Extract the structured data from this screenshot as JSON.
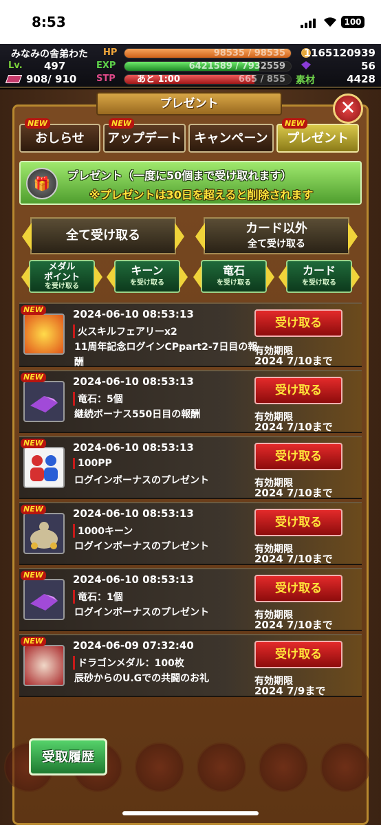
{
  "status": {
    "time": "8:53",
    "battery": "100"
  },
  "player": {
    "name": "みなみの舎弟わた",
    "lv_label": "Lv.",
    "lv": "497",
    "cards": "908/ 910",
    "hp_label": "HP",
    "hp": "98535 / 98535",
    "exp_label": "EXP",
    "exp": "6421589 / 7932559",
    "stp_label": "STP",
    "stp_remaining": "あと 1:00",
    "stp": "665 / 855",
    "gold": "1165120939",
    "gems": "56",
    "sozai_label": "素材",
    "sozai": "4428",
    "hp_ratio": 1.0,
    "exp_ratio": 0.81,
    "stp_ratio": 0.78
  },
  "panel": {
    "title": "プレゼント",
    "close": "✕"
  },
  "tabs": [
    {
      "label": "おしらせ",
      "new": "NEW"
    },
    {
      "label": "アップデート",
      "new": "NEW"
    },
    {
      "label": "キャンペーン",
      "new": ""
    },
    {
      "label": "プレゼント",
      "new": "NEW"
    }
  ],
  "notice": {
    "line1": "プレゼント（一度に50個まで受け取れます）",
    "line2": "※プレゼントは30日を超えると削除されます"
  },
  "actions": {
    "receive_all": "全て受け取る",
    "except_cards_1": "カード以外",
    "except_cards_2": "全て受け取る",
    "medal_1": "メダル",
    "medal_2": "ポイント",
    "medal_3": "を受け取る",
    "kin_1": "キーン",
    "kin_2": "を受け取る",
    "ryu_1": "竜石",
    "ryu_2": "を受け取る",
    "card_1": "カード",
    "card_2": "を受け取る"
  },
  "presents": [
    {
      "new": "NEW",
      "date": "2024-06-10 08:53:13",
      "item": "火スキルフェアリーx2",
      "desc": "11周年記念ログインCPpart2-7日目の報酬",
      "button": "受け取る",
      "exp_label": "有効期限",
      "exp": "2024 7/10まで"
    },
    {
      "new": "NEW",
      "date": "2024-06-10 08:53:13",
      "item": "竜石：5個",
      "desc": "継続ボーナス550日目の報酬",
      "button": "受け取る",
      "exp_label": "有効期限",
      "exp": "2024 7/10まで"
    },
    {
      "new": "NEW",
      "date": "2024-06-10 08:53:13",
      "item": "100PP",
      "desc": "ログインボーナスのプレゼント",
      "button": "受け取る",
      "exp_label": "有効期限",
      "exp": "2024 7/10まで"
    },
    {
      "new": "NEW",
      "date": "2024-06-10 08:53:13",
      "item": "1000キーン",
      "desc": "ログインボーナスのプレゼント",
      "button": "受け取る",
      "exp_label": "有効期限",
      "exp": "2024 7/10まで"
    },
    {
      "new": "NEW",
      "date": "2024-06-10 08:53:13",
      "item": "竜石：1個",
      "desc": "ログインボーナスのプレゼント",
      "button": "受け取る",
      "exp_label": "有効期限",
      "exp": "2024 7/10まで"
    },
    {
      "new": "NEW",
      "date": "2024-06-09 07:32:40",
      "item": "ドラゴンメダル：100枚",
      "desc": "辰砂からのU.Gでの共闘のお礼",
      "button": "受け取る",
      "exp_label": "有効期限",
      "exp": "2024 7/9まで"
    }
  ],
  "history": "受取履歴"
}
